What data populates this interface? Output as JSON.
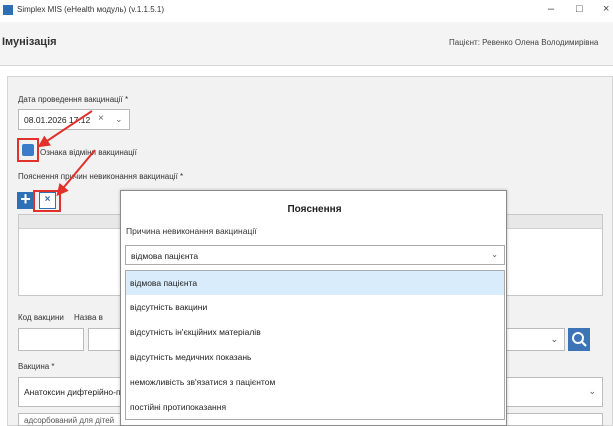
{
  "window": {
    "title": "Simplex MIS (eHealth модуль) (v.1.1.5.1)",
    "minimize": "–",
    "maximize": "□",
    "close": "×"
  },
  "header": {
    "title": "Імунізація",
    "patient": "Пацієнт: Ревенко Олена Володимирівна"
  },
  "form": {
    "date_label": "Дата проведення вакцинації *",
    "date_value": "08.01.2026 17:12",
    "date_clear": "×",
    "date_chevron": "⌄",
    "cancel_label": "Ознака відміни вакцинації",
    "reasons_label": "Пояснення причин невиконання вакцинації *",
    "add_icon": "+",
    "delete_icon": "×",
    "code_label": "Код вакцини",
    "name_label": "Назва в",
    "vaccine_label": "Вакцина *",
    "vaccine_value": "Анатоксин дифтерійно-п",
    "next_row_value": "адсорбований для дітей",
    "chevron": "⌄"
  },
  "popup": {
    "title": "Пояснення",
    "field_label": "Причина невиконання вакцинації",
    "selected": "відмова пацієнта",
    "chevron": "⌄",
    "options": [
      "відмова пацієнта",
      "відсутність вакцини",
      "відсутність ін'єкційних матеріалів",
      "відсутність медичних показань",
      "неможливість зв'язатися з пацієнтом",
      "постійні протипоказання"
    ]
  },
  "colors": {
    "accent": "#2f6fb3",
    "highlight": "#e0312b",
    "selected_option": "#d9ecfb"
  }
}
